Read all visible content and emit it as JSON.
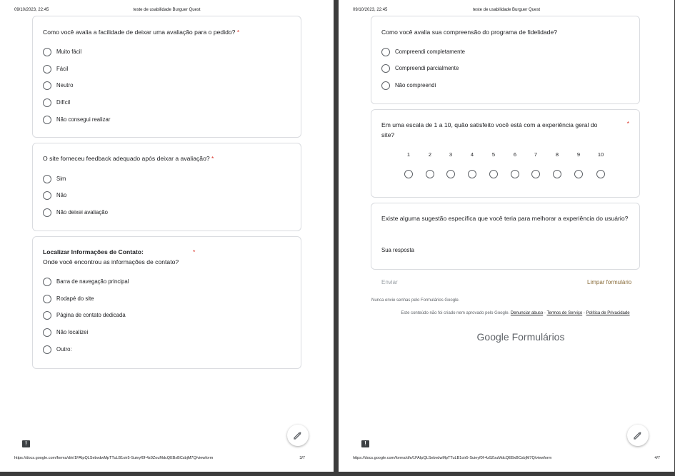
{
  "header": {
    "datetime": "09/10/2023, 22:45",
    "title": "teste de usabilidade Burguer Quest"
  },
  "footer": {
    "url": "https://docs.google.com/forms/d/e/1FAIpQLSebvdwMpTTuLB1oir5-Suieyf0f-4z9ZouMdcQEBxBCsbjM7Q/viewform",
    "left_page": "3/7",
    "right_page": "4/7"
  },
  "left": {
    "q1": {
      "text": "Como você avalia a facilidade de deixar uma avaliação para o pedido?",
      "required": "*",
      "options": [
        "Muito fácil",
        "Fácil",
        "Neutro",
        "Difícil",
        "Não consegui realizar"
      ]
    },
    "q2": {
      "text": "O site forneceu feedback adequado após deixar a avaliação?",
      "required": "*",
      "options": [
        "Sim",
        "Não",
        "Não deixei avaliação"
      ]
    },
    "q3": {
      "title": "Localizar Informações de Contato:",
      "subtitle": "Onde você encontrou as informações de contato?",
      "required": "*",
      "options": [
        "Barra de navegação principal",
        "Rodapé do site",
        "Página de contato dedicada",
        "Não localizei",
        "Outro:"
      ]
    }
  },
  "right": {
    "q4": {
      "text": "Como você avalia sua compreensão do programa de fidelidade?",
      "options": [
        "Compreendi completamente",
        "Compreendi parcialmente",
        "Não compreendi"
      ]
    },
    "q5": {
      "text": "Em uma escala de 1 a 10, quão satisfeito você está com a experiência geral do site?",
      "required": "*",
      "scale": [
        "1",
        "2",
        "3",
        "4",
        "5",
        "6",
        "7",
        "8",
        "9",
        "10"
      ]
    },
    "q6": {
      "text": "Existe alguma sugestão específica que você teria para melhorar a experiência do usuário?",
      "hint": "Sua resposta"
    },
    "submit_label": "Enviar",
    "clear_label": "Limpar formulário",
    "password_warning": "Nunca envie senhas pelo Formulários Google.",
    "disclaimer_prefix": "Este conteúdo não foi criado nem aprovado pelo Google.",
    "link_abuse": "Denunciar abuso",
    "link_terms": "Termos de Serviço",
    "link_privacy": "Política de Privacidade",
    "separator": " - ",
    "brand_google": "Google",
    "brand_forms": "Formulários"
  },
  "icons": {
    "feedback": "feedback-icon",
    "edit": "pencil-icon",
    "accent": "#d93025"
  }
}
